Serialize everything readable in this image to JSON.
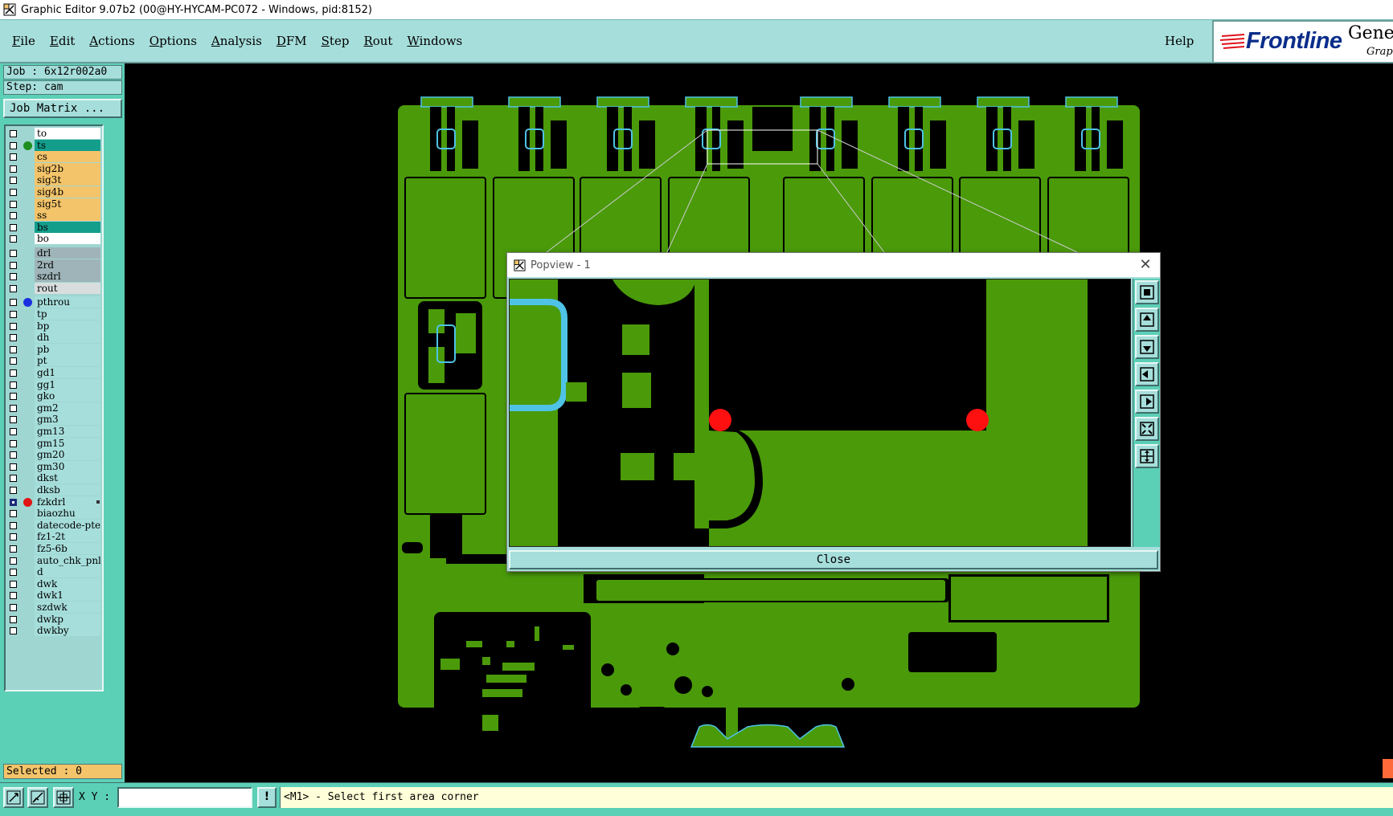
{
  "window": {
    "title": "Graphic Editor 9.07b2 (00@HY-HYCAM-PC072 - Windows, pid:8152)"
  },
  "menubar": {
    "items": [
      "File",
      "Edit",
      "Actions",
      "Options",
      "Analysis",
      "DFM",
      "Step",
      "Rout",
      "Windows"
    ],
    "help": "Help",
    "brand_frontline": "Frontline",
    "brand_genesis": "Genesis",
    "brand_graphic": "Graphic"
  },
  "left_panel": {
    "job": "Job : 6x12r002a0",
    "step": "Step: cam",
    "job_matrix_button": "Job Matrix ...",
    "selected": "Selected : 0"
  },
  "layers": [
    {
      "name": "to",
      "color": "#ffffff",
      "dot": null,
      "checked": false
    },
    {
      "name": "ts",
      "color": "#139e8c",
      "dot": "#1f8f1f",
      "checked": false
    },
    {
      "name": "cs",
      "color": "#f4c46a",
      "dot": null,
      "checked": false
    },
    {
      "name": "sig2b",
      "color": "#f4c46a",
      "dot": null,
      "checked": false
    },
    {
      "name": "sig3t",
      "color": "#f4c46a",
      "dot": null,
      "checked": false
    },
    {
      "name": "sig4b",
      "color": "#f4c46a",
      "dot": null,
      "checked": false
    },
    {
      "name": "sig5t",
      "color": "#f4c46a",
      "dot": null,
      "checked": false
    },
    {
      "name": "ss",
      "color": "#f4c46a",
      "dot": null,
      "checked": false
    },
    {
      "name": "bs",
      "color": "#139e8c",
      "dot": null,
      "checked": false
    },
    {
      "name": "bo",
      "color": "#ffffff",
      "dot": null,
      "checked": false
    },
    {
      "name": "drl",
      "color": "#9fb4b8",
      "dot": null,
      "checked": false
    },
    {
      "name": "2rd",
      "color": "#9fb4b8",
      "dot": null,
      "checked": false
    },
    {
      "name": "szdrl",
      "color": "#9fb4b8",
      "dot": null,
      "checked": false
    },
    {
      "name": "rout",
      "color": "#d8dede",
      "dot": null,
      "checked": false
    },
    {
      "name": "pthrou",
      "color": "#a6dedb",
      "dot": "#1a2ee0",
      "checked": false
    },
    {
      "name": "tp",
      "color": "#a6dedb",
      "dot": null,
      "checked": false
    },
    {
      "name": "bp",
      "color": "#a6dedb",
      "dot": null,
      "checked": false
    },
    {
      "name": "dh",
      "color": "#a6dedb",
      "dot": null,
      "checked": false
    },
    {
      "name": "pb",
      "color": "#a6dedb",
      "dot": null,
      "checked": false
    },
    {
      "name": "pt",
      "color": "#a6dedb",
      "dot": null,
      "checked": false
    },
    {
      "name": "gd1",
      "color": "#a6dedb",
      "dot": null,
      "checked": false
    },
    {
      "name": "gg1",
      "color": "#a6dedb",
      "dot": null,
      "checked": false
    },
    {
      "name": "gko",
      "color": "#a6dedb",
      "dot": null,
      "checked": false
    },
    {
      "name": "gm2",
      "color": "#a6dedb",
      "dot": null,
      "checked": false
    },
    {
      "name": "gm3",
      "color": "#a6dedb",
      "dot": null,
      "checked": false
    },
    {
      "name": "gm13",
      "color": "#a6dedb",
      "dot": null,
      "checked": false
    },
    {
      "name": "gm15",
      "color": "#a6dedb",
      "dot": null,
      "checked": false
    },
    {
      "name": "gm20",
      "color": "#a6dedb",
      "dot": null,
      "checked": false
    },
    {
      "name": "gm30",
      "color": "#a6dedb",
      "dot": null,
      "checked": false
    },
    {
      "name": "dkst",
      "color": "#a6dedb",
      "dot": null,
      "checked": false
    },
    {
      "name": "dksb",
      "color": "#a6dedb",
      "dot": null,
      "checked": false
    },
    {
      "name": "fzkdrl",
      "color": "#a6dedb",
      "dot": "#e01414",
      "checked": true
    },
    {
      "name": "biaozhu",
      "color": "#a6dedb",
      "dot": null,
      "checked": false
    },
    {
      "name": "datecode-pte",
      "color": "#a6dedb",
      "dot": null,
      "checked": false
    },
    {
      "name": "fz1-2t",
      "color": "#a6dedb",
      "dot": null,
      "checked": false
    },
    {
      "name": "fz5-6b",
      "color": "#a6dedb",
      "dot": null,
      "checked": false
    },
    {
      "name": "auto_chk_pnl",
      "color": "#a6dedb",
      "dot": null,
      "checked": false
    },
    {
      "name": "d",
      "color": "#a6dedb",
      "dot": null,
      "checked": false
    },
    {
      "name": "dwk",
      "color": "#a6dedb",
      "dot": null,
      "checked": false
    },
    {
      "name": "dwk1",
      "color": "#a6dedb",
      "dot": null,
      "checked": false
    },
    {
      "name": "szdwk",
      "color": "#a6dedb",
      "dot": null,
      "checked": false
    },
    {
      "name": "dwkp",
      "color": "#a6dedb",
      "dot": null,
      "checked": false
    },
    {
      "name": "dwkby",
      "color": "#a6dedb",
      "dot": null,
      "checked": false
    }
  ],
  "popview": {
    "title": "Popview - 1",
    "close_button": "Close"
  },
  "bottombar": {
    "xy_label": "X Y :",
    "xy_value": "",
    "exclaim": "!",
    "status": "<M1> - Select first area corner"
  },
  "colors": {
    "board_green": "#4a9a0a",
    "outline_cyan": "#4fc3e6",
    "pad_red": "#ff1010",
    "panel_teal": "#5ccfb7",
    "menubar": "#a6dedb"
  }
}
